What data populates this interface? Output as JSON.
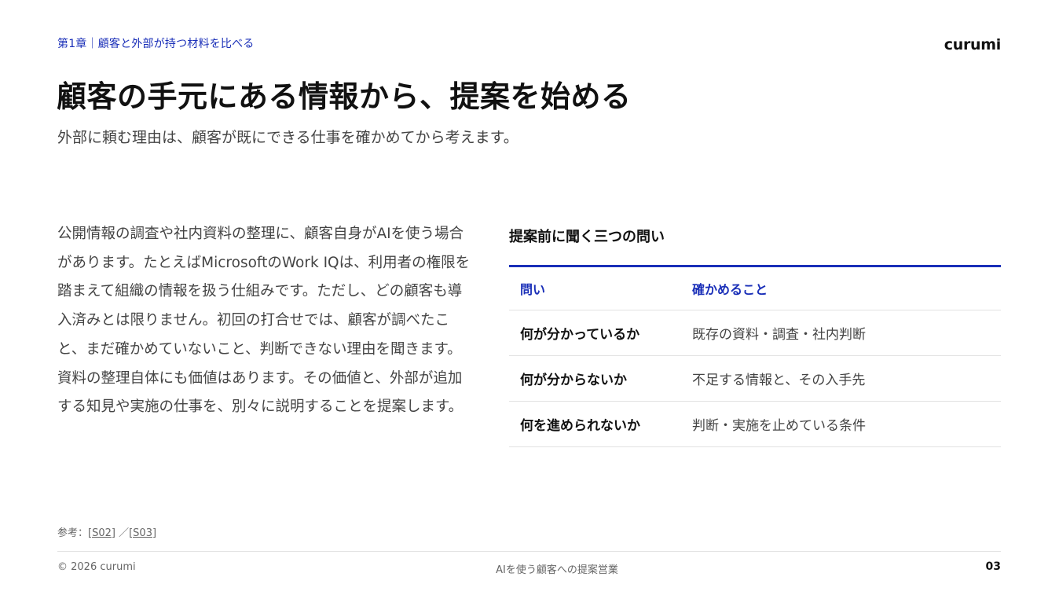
{
  "header": {
    "chapter": "第1章｜顧客と外部が持つ材料を比べる",
    "logo": "curumi"
  },
  "main": {
    "title": "顧客の手元にある情報から、提案を始める",
    "subtitle": "外部に頼む理由は、顧客が既にできる仕事を確かめてから考えます。",
    "body": "公開情報の調査や社内資料の整理に、顧客自身がAIを使う場合があります。たとえばMicrosoftのWork IQは、利用者の権限を踏まえて組織の情報を扱う仕組みです。ただし、どの顧客も導入済みとは限りません。初回の打合せでは、顧客が調べたこと、まだ確かめていないこと、判断できない理由を聞きます。資料の整理自体にも価値はあります。その価値と、外部が追加する知見や実施の仕事を、別々に説明することを提案します。"
  },
  "panel": {
    "title": "提案前に聞く三つの問い",
    "headers": [
      "問い",
      "確かめること"
    ],
    "rows": [
      {
        "question": "何が分かっているか",
        "check": "既存の資料・調査・社内判断"
      },
      {
        "question": "何が分からないか",
        "check": "不足する情報と、その入手先"
      },
      {
        "question": "何を進められないか",
        "check": "判断・実施を止めている条件"
      }
    ]
  },
  "footer": {
    "refs_label": "参考：",
    "ref1": "[S02]",
    "ref_sep": "／",
    "ref2": "[S03]",
    "copyright": "© 2026 curumi",
    "deck_title": "AIを使う顧客への提案営業",
    "page_number": "03"
  },
  "colors": {
    "accent": "#1a2fb8",
    "text": "#111111",
    "muted": "#444444",
    "rule": "#e2e2e2"
  }
}
